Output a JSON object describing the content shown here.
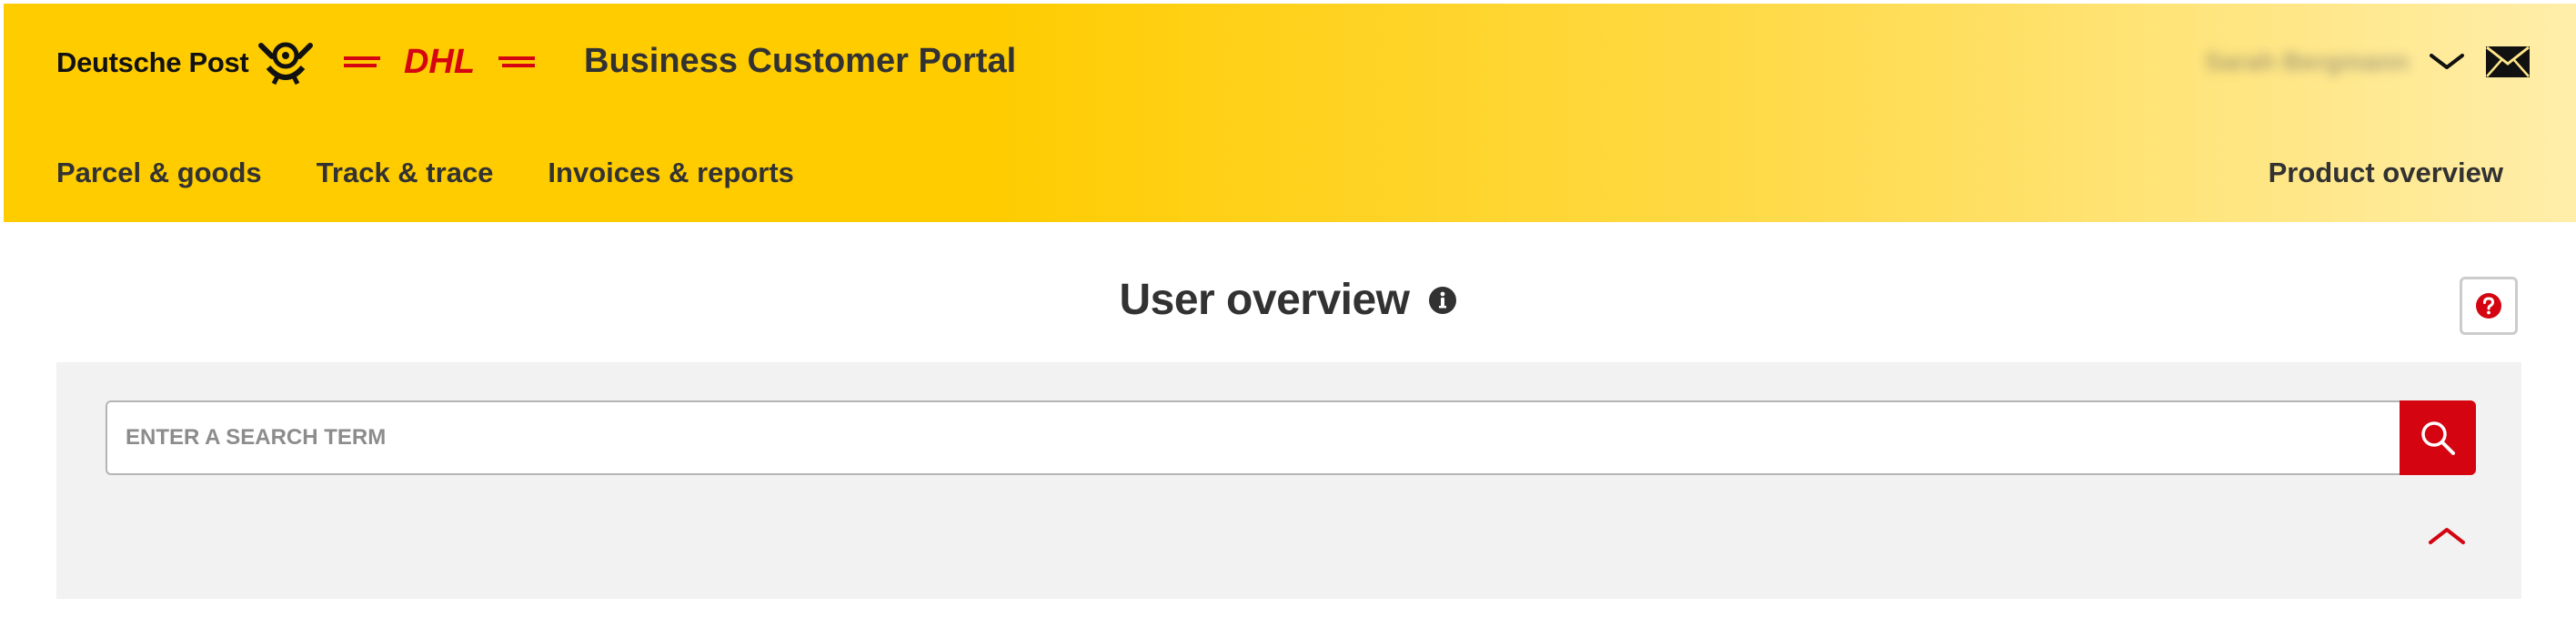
{
  "brand": {
    "deutsche_post": "Deutsche Post",
    "dhl": "DHL",
    "portal_title": "Business Customer Portal"
  },
  "user": {
    "name": "Sarah Bergmann"
  },
  "nav": {
    "items": [
      {
        "label": "Parcel & goods"
      },
      {
        "label": "Track & trace"
      },
      {
        "label": "Invoices & reports"
      }
    ],
    "right_label": "Product overview"
  },
  "page": {
    "title": "User overview"
  },
  "search": {
    "placeholder": "ENTER A SEARCH TERM",
    "value": ""
  },
  "colors": {
    "brand_yellow": "#ffcc00",
    "brand_red": "#d40511",
    "text_dark": "#323232",
    "panel_bg": "#f2f2f2"
  },
  "icons": {
    "post_horn": "post-horn-icon",
    "user_menu": "chevron-down-icon",
    "messages": "mail-icon",
    "info": "info-icon",
    "help": "help-icon",
    "search": "search-icon",
    "collapse": "chevron-up-icon"
  }
}
